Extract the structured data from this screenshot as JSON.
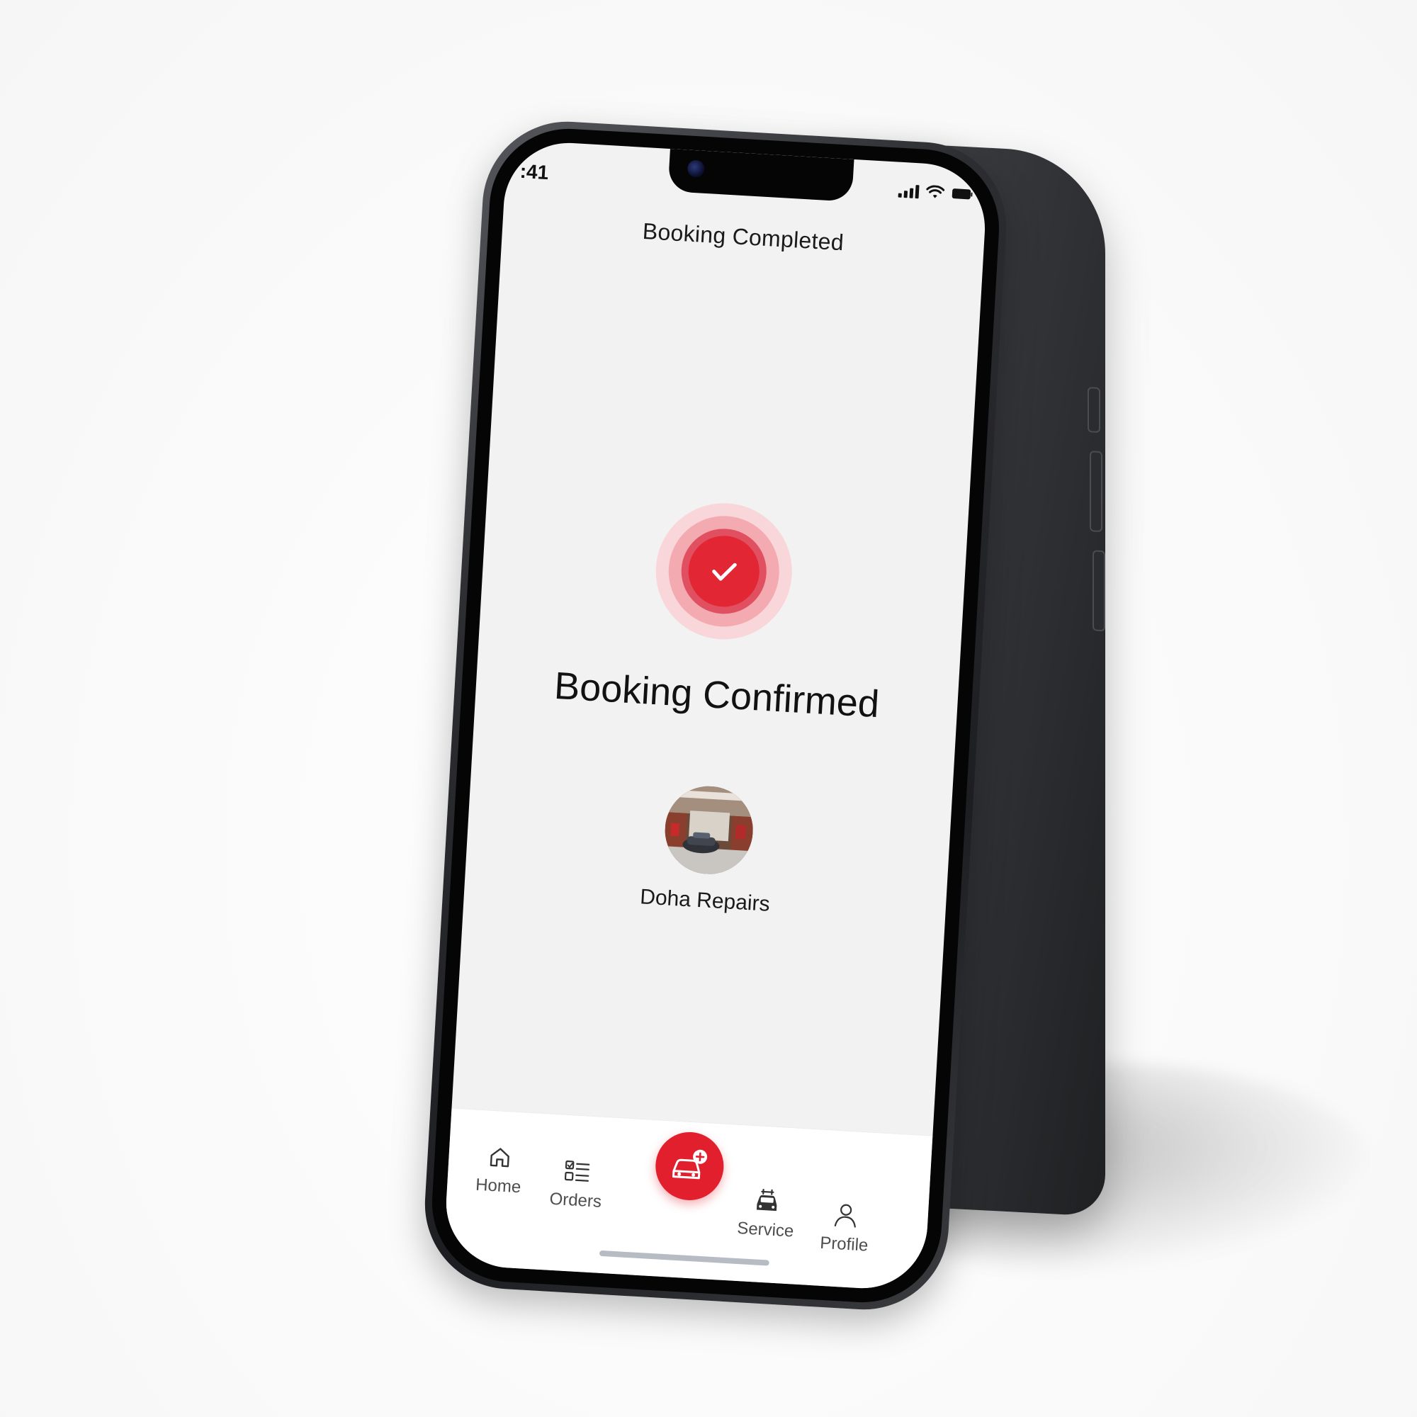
{
  "status_bar": {
    "time": ":41",
    "icons": [
      "signal-icon",
      "wifi-icon",
      "battery-icon"
    ]
  },
  "header": {
    "title": "Booking Completed"
  },
  "confirmation": {
    "icon": "check-icon",
    "title": "Booking Confirmed",
    "accent_color": "#E22634"
  },
  "provider": {
    "name": "Doha Repairs"
  },
  "tabbar": {
    "items": [
      {
        "label": "Home",
        "icon": "home-icon"
      },
      {
        "label": "Orders",
        "icon": "orders-list-icon"
      },
      {
        "label": "",
        "icon": "add-car-icon"
      },
      {
        "label": "Service",
        "icon": "car-service-icon"
      },
      {
        "label": "Profile",
        "icon": "user-icon"
      }
    ]
  }
}
